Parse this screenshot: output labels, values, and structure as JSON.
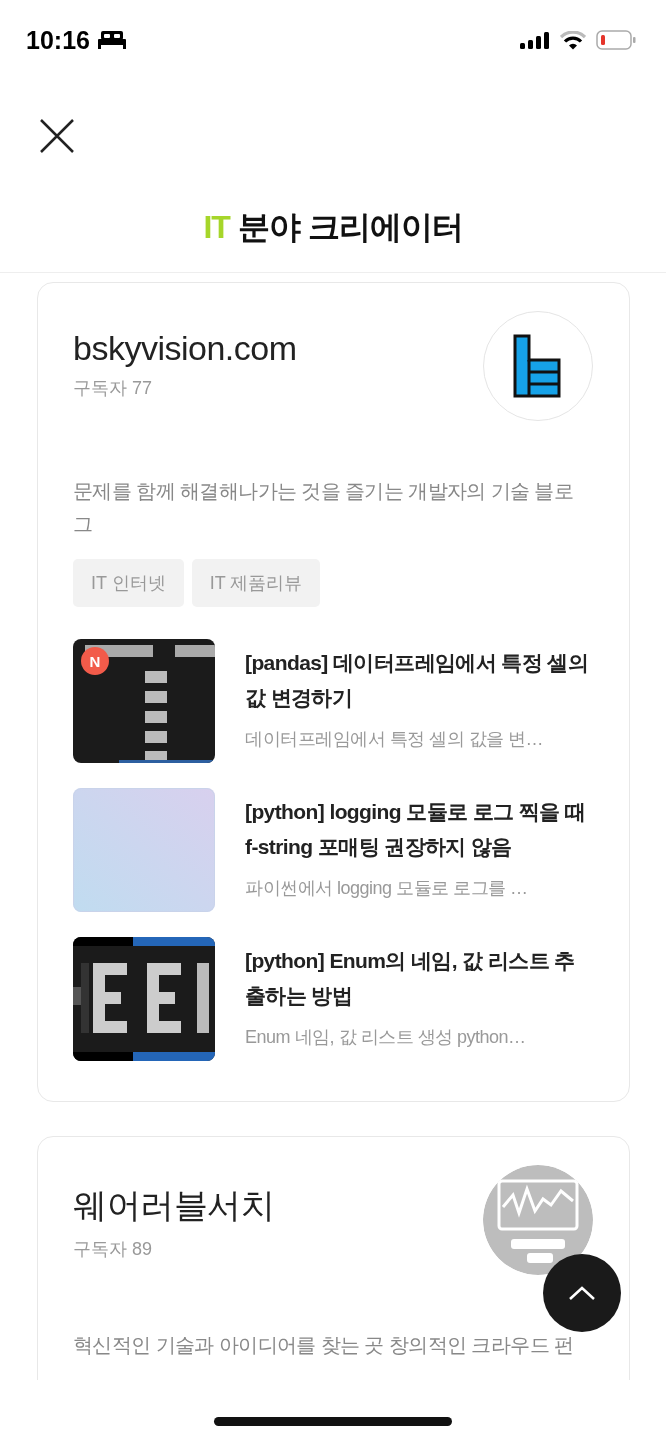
{
  "status_bar": {
    "time": "10:16"
  },
  "header": {
    "title_highlight": "IT",
    "title": "분야 크리에이터"
  },
  "creators": [
    {
      "name": "bskyvision.com",
      "subscribers": "구독자 77",
      "avatar": {
        "kind": "blocks"
      },
      "description": "문제를 함께 해결해나가는 것을 즐기는 개발자의 기술 블로그",
      "tags": [
        "IT 인터넷",
        "IT 제품리뷰"
      ],
      "posts": [
        {
          "title": "[pandas] 데이터프레임에서 특정 셀의 값 변경하기",
          "excerpt": "데이터프레임에서 특정 셀의 값을 변…",
          "badge": "N",
          "thumbnail": {
            "kind": "terminal"
          }
        },
        {
          "title": "[python] logging 모듈로 로그 찍을 때 f-string 포매팅 권장하지 않음",
          "excerpt": "파이썬에서 logging 모듈로 로그를 …",
          "thumbnail": {
            "kind": "gradient"
          }
        },
        {
          "title": "[python] Enum의 네임, 값 리스트 추출하는 방법",
          "excerpt": "Enum 네임, 값 리스트 생성 python…",
          "thumbnail": {
            "kind": "pixel"
          }
        }
      ]
    },
    {
      "name": "웨어러블서치",
      "subscribers": "구독자 89",
      "avatar": {
        "kind": "wave"
      },
      "description": "혁신적인 기술과 아이디어를 찾는 곳 창의적인 크라우드 펀"
    }
  ]
}
